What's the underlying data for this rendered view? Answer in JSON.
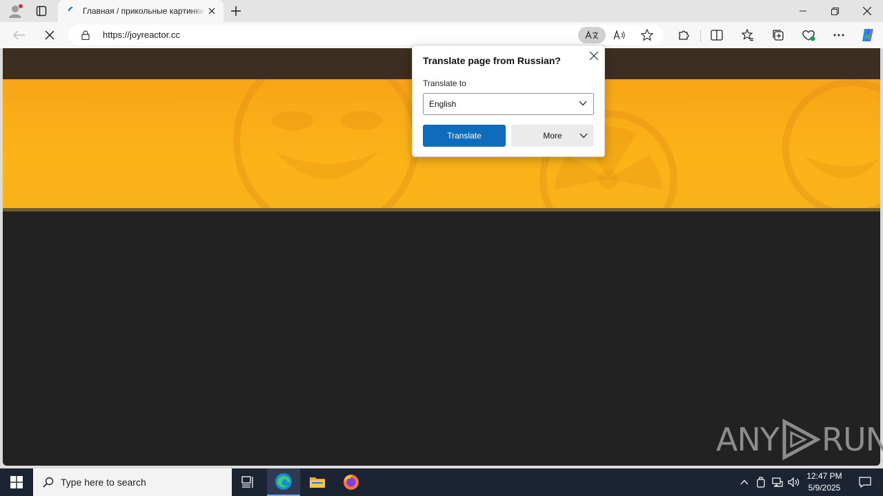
{
  "browser": {
    "tab": {
      "title": "Главная / прикольные картинки"
    },
    "address_bar": {
      "url": "https://joyreactor.cc"
    }
  },
  "translate_popup": {
    "title": "Translate page from Russian?",
    "translate_to_label": "Translate to",
    "selected_language": "English",
    "translate_button": "Translate",
    "more_button": "More"
  },
  "taskbar": {
    "search_placeholder": "Type here to search",
    "time": "12:47 PM",
    "date": "5/9/2025"
  },
  "watermark": {
    "left": "ANY",
    "right": "RUN"
  },
  "colors": {
    "accent": "#0f6cbd",
    "banner": "#fbb318",
    "page_bg": "#222222",
    "taskbar": "#1c2333"
  }
}
